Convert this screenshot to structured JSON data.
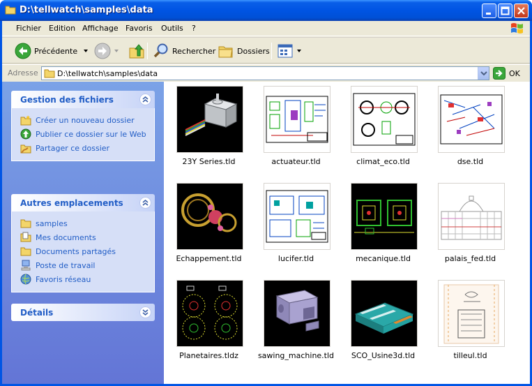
{
  "window": {
    "title": "D:\\tellwatch\\samples\\data"
  },
  "menu": [
    "Fichier",
    "Edition",
    "Affichage",
    "Favoris",
    "Outils",
    "?"
  ],
  "toolbar": {
    "back": "Précédente",
    "search": "Rechercher",
    "folders": "Dossiers"
  },
  "address": {
    "label": "Adresse",
    "value": "D:\\tellwatch\\samples\\data",
    "go": "OK"
  },
  "taskpane": {
    "file_tasks": {
      "title": "Gestion des fichiers",
      "items": [
        "Créer un nouveau dossier",
        "Publier ce dossier sur le Web",
        "Partager ce dossier"
      ]
    },
    "other_places": {
      "title": "Autres emplacements",
      "items": [
        "samples",
        "Mes documents",
        "Documents partagés",
        "Poste de travail",
        "Favoris réseau"
      ]
    },
    "details": {
      "title": "Détails"
    }
  },
  "files": [
    {
      "name": "23Y Series.tld"
    },
    {
      "name": "actuateur.tld"
    },
    {
      "name": "climat_eco.tld"
    },
    {
      "name": "dse.tld"
    },
    {
      "name": "Echappement.tld"
    },
    {
      "name": "lucifer.tld"
    },
    {
      "name": "mecanique.tld"
    },
    {
      "name": "palais_fed.tld"
    },
    {
      "name": "Planetaires.tldz"
    },
    {
      "name": "sawing_machine.tld"
    },
    {
      "name": "SCO_Usine3d.tld"
    },
    {
      "name": "tilleul.tld"
    }
  ]
}
